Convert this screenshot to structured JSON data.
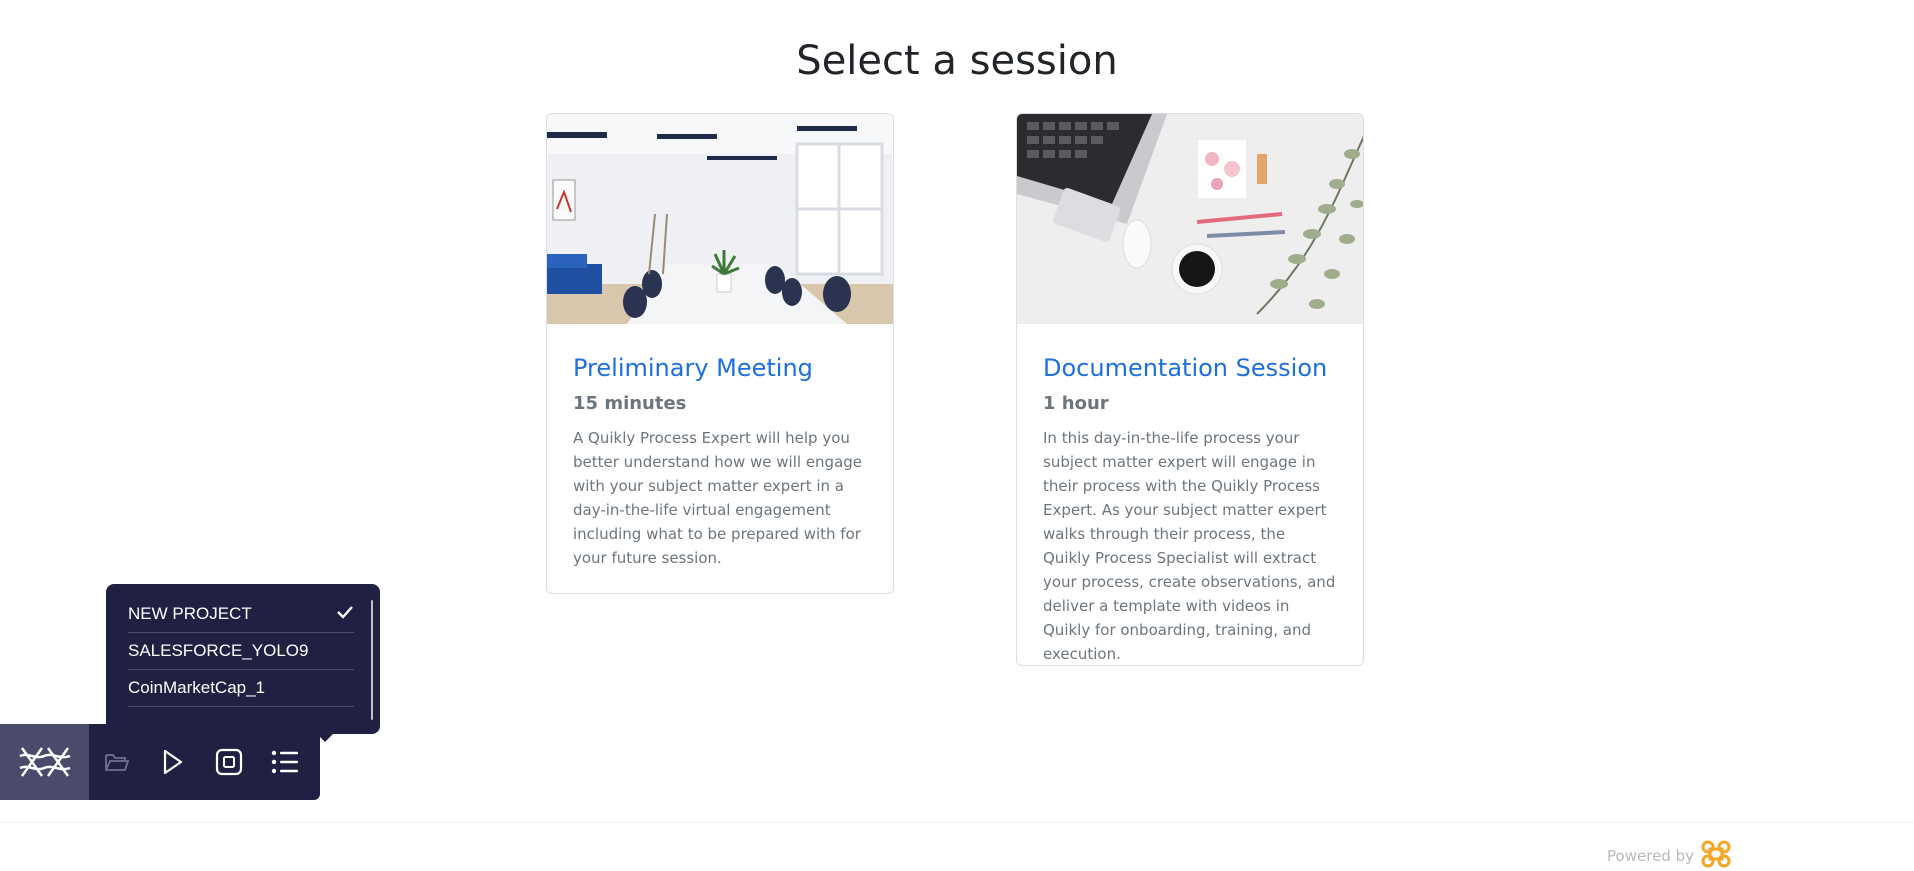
{
  "page": {
    "title": "Select a session"
  },
  "sessions": [
    {
      "title": "Preliminary Meeting",
      "duration": "15 minutes",
      "description": "A Quikly Process Expert will help you better understand how we will engage with your subject matter expert in a day-in-the-life virtual engagement including what to be prepared with for your future session.",
      "image": "conference-room-photo"
    },
    {
      "title": "Documentation Session",
      "duration": "1 hour",
      "description": "In this day-in-the-life process your subject matter expert will engage in their process with the Quikly Process Expert. As your subject matter expert walks through their process, the Quikly Process Specialist will extract your process, create observations, and deliver a template with videos in Quikly for onboarding, training, and execution.",
      "image": "desk-laptop-coffee-photo"
    }
  ],
  "project_menu": {
    "items": [
      {
        "label": "NEW PROJECT",
        "selected": true
      },
      {
        "label": "SALESFORCE_YOLO9",
        "selected": false
      },
      {
        "label": "CoinMarketCap_1",
        "selected": false
      }
    ]
  },
  "toolbar": {
    "tools": [
      "logo-icon",
      "folder-open-icon",
      "play-icon",
      "record-stop-icon",
      "list-icon"
    ]
  },
  "footer": {
    "powered_by": "Powered by",
    "logo_icon": "command-key-icon"
  },
  "colors": {
    "accent": "#1d6fe0",
    "toolbar_bg": "#202142",
    "logo_orange": "#f5a623"
  }
}
